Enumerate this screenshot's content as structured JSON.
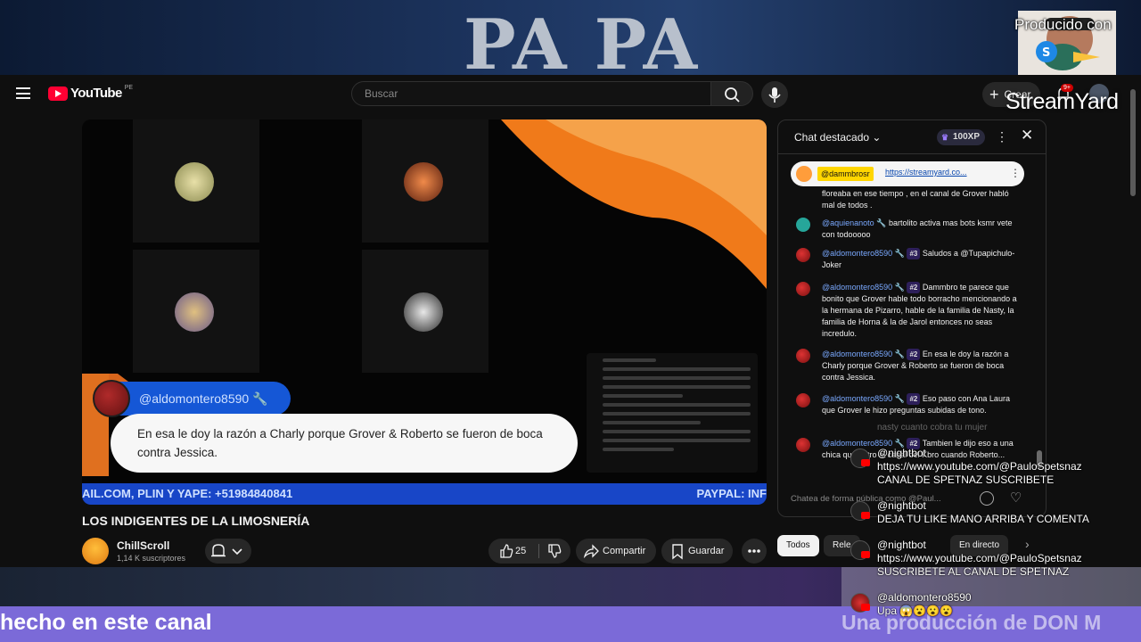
{
  "stream": {
    "banner_text": "PA PA",
    "producido": "Producido con",
    "watermark": "StreamYard",
    "bottom_left": "hecho en este canal",
    "bottom_right": "Una producción de DON M"
  },
  "header": {
    "logo_text": "YouTube",
    "country": "PE",
    "search_placeholder": "Buscar",
    "create_label": "Crear",
    "notif_count": "9+"
  },
  "video": {
    "overlay_username": "@aldomontero8590",
    "overlay_message": "En esa le doy la razón a Charly porque Grover & Roberto se fueron de boca contra Jessica.",
    "ticker_left": "AIL.COM, PLIN Y YAPE: +51984840841",
    "ticker_right": "PAYPAL: INF"
  },
  "meta": {
    "title": "LOS INDIGENTES DE LA LIMOSNERÍA",
    "channel": "ChillScroll",
    "subs": "1,14 K suscriptores",
    "likes": "25",
    "share": "Compartir",
    "save": "Guardar"
  },
  "chat": {
    "title": "Chat destacado",
    "xp": "100XP",
    "pinned_user": "@dammbrosr",
    "pinned_link": "https://streamyard.co...",
    "input_placeholder": "Chatea de forma pública como @Paul...",
    "messages": [
      {
        "author": "",
        "badge": "",
        "text": "floreaba en ese tiempo , en el canal de Grover habló mal de todos ."
      },
      {
        "author": "@aquienanoto",
        "badge": "",
        "text": "bartolito activa mas bots ksmr vete con todooooo"
      },
      {
        "author": "@aldomontero8590",
        "badge": "#3",
        "text": "Saludos a @Tupapichulo-Joker"
      },
      {
        "author": "@aldomontero8590",
        "badge": "#2",
        "text": "Dammbro te parece que bonito que Grover hable todo borracho mencionando a la hermana de Pizarro, hable de la familia de Nasty, la familia de Horna & la de Jarol entonces no seas incredulo."
      },
      {
        "author": "@aldomontero8590",
        "badge": "#2",
        "text": "En esa le doy la razón a Charly porque Grover & Roberto se fueron de boca contra Jessica."
      },
      {
        "author": "@aldomontero8590",
        "badge": "#2",
        "text": "Eso paso con Ana Laura que Grover le hizo preguntas subidas de tono."
      },
      {
        "author": "@aldomontero8590",
        "badge": "#2",
        "text": "Tambien le dijo eso a una chica que entro al canal del Kbro cuando Roberto..."
      }
    ]
  },
  "chips": {
    "all": "Todos",
    "relevant": "Rele",
    "live": "En directo"
  },
  "floating_chat": {
    "faded": "nasty cuanto cobra tu mujer",
    "items": [
      {
        "author": "@nightbot",
        "text": "https://www.youtube.com/@PauloSpetsnaz CANAL DE SPETNAZ SUSCRIBETE"
      },
      {
        "author": "@nightbot",
        "text": "DEJA TU LIKE MANO ARRIBA Y COMENTA"
      },
      {
        "author": "@nightbot",
        "text": "https://www.youtube.com/@PauloSpetsnaz SUSCRIBETE AL CANAL DE SPETNAZ"
      },
      {
        "author": "@aldomontero8590",
        "text": "Upa 😱😮😮😮"
      }
    ]
  },
  "colors": {
    "yt_red": "#ff0033",
    "accent_blue": "#1557d6",
    "mention_blue": "#7aa9ff",
    "pinned_yellow": "#ffd600",
    "banner_purple": "#7b6ad8",
    "wave_orange": "#f07a1a"
  }
}
